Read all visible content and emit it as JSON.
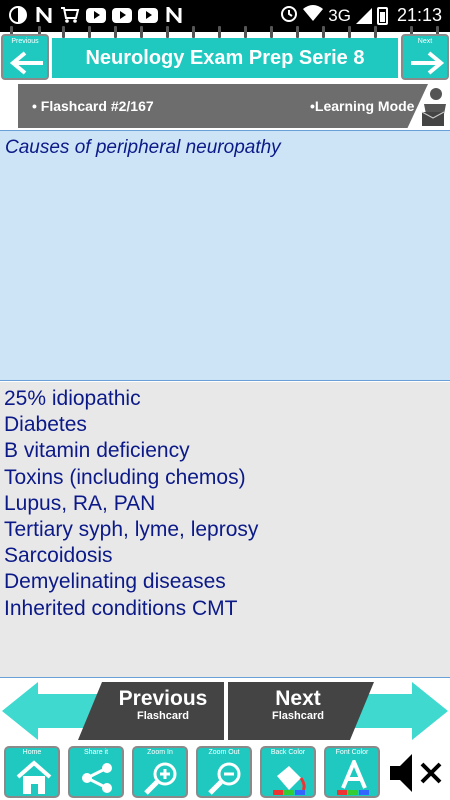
{
  "status_bar": {
    "time": "21:13",
    "network": "3G",
    "left_icons": [
      "brightness-icon",
      "n-icon",
      "cart-icon",
      "youtube-icon",
      "youtube-icon",
      "youtube-icon",
      "n-icon"
    ],
    "right_icons": [
      "alarm-icon",
      "wifi-icon",
      "signal-icon",
      "battery-icon"
    ]
  },
  "header": {
    "title": "Neurology Exam Prep Serie 8",
    "prev_caption": "Previous",
    "next_caption": "Next"
  },
  "info_bar": {
    "flashcard_label": "• Flashcard #2/167",
    "mode_label": "•Learning Mode"
  },
  "question": {
    "text": "Causes of peripheral neuropathy"
  },
  "answer": {
    "items": [
      "25% idiopathic",
      "Diabetes",
      "B vitamin deficiency",
      "Toxins (including chemos)",
      "Lupus, RA, PAN",
      "Tertiary syph, lyme, leprosy",
      "Sarcoidosis",
      "Demyelinating diseases",
      "Inherited conditions CMT"
    ]
  },
  "bottom_nav": {
    "previous_label": "Previous",
    "previous_sub": "Flashcard",
    "next_label": "Next",
    "next_sub": "Flashcard"
  },
  "toolbar": {
    "home": "Home",
    "share": "Share it",
    "zoom_in": "Zoom In",
    "zoom_out": "Zoom Out",
    "back_color": "Back Color",
    "font_color": "Font Color"
  },
  "colors": {
    "accent": "#1fc9c0",
    "bar_gray": "#6d6d6d",
    "text_blue": "#0c1a88",
    "question_bg": "#cde4f7",
    "answer_bg": "#e8e8e8"
  }
}
